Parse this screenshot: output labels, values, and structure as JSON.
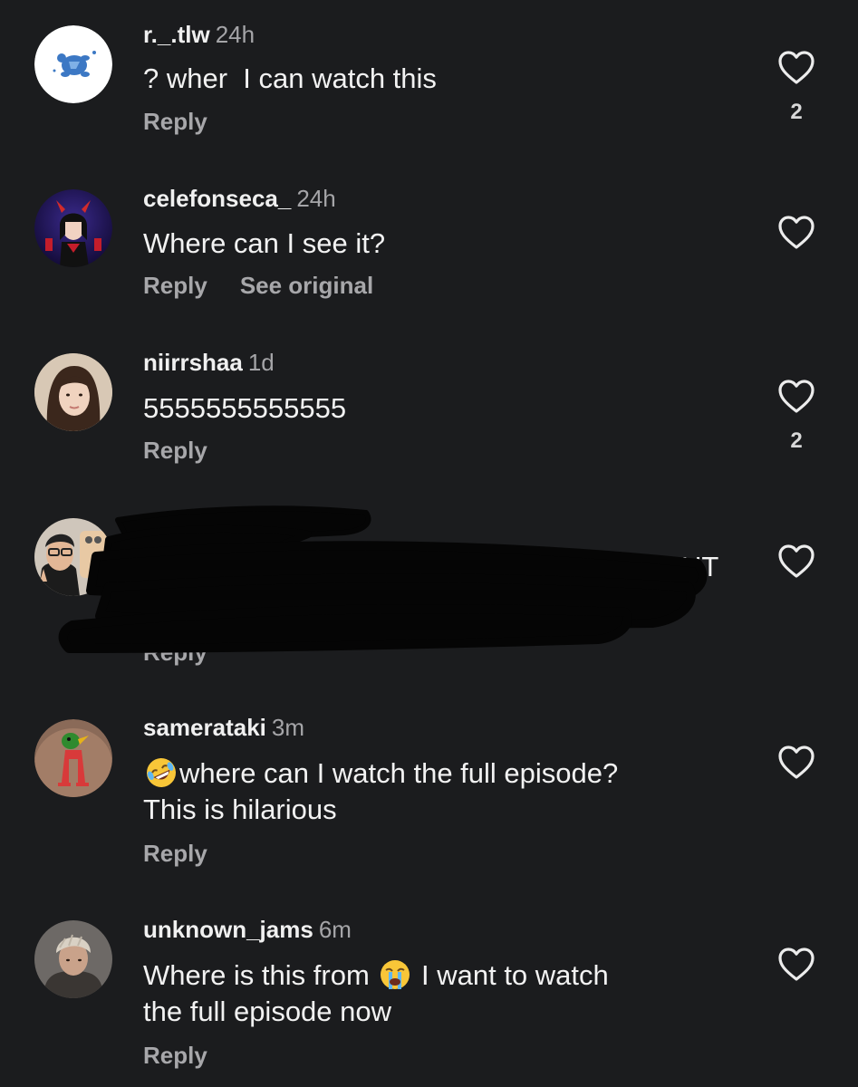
{
  "comments": [
    {
      "username": "r._.tlw",
      "time": "24h",
      "text": "? wher  I can watch this",
      "reply_label": "Reply",
      "like_count": "2"
    },
    {
      "username": "celefonseca_",
      "time": "24h",
      "text": "Where can I see it?",
      "reply_label": "Reply",
      "see_original_label": "See original"
    },
    {
      "username": "niirrshaa",
      "time": "1d",
      "text": "5555555555555",
      "reply_label": "Reply",
      "like_count": "2"
    },
    {
      "redacted": true,
      "reply_partial": "Reply",
      "text_partial": "UT"
    },
    {
      "username": "samerataki",
      "time": "3m",
      "emoji": "rolling-on-floor-laughing-emoji",
      "text_line1": "where can I watch the full episode?",
      "text_line2": "This is hilarious",
      "reply_label": "Reply"
    },
    {
      "username": "unknown_jams",
      "time": "6m",
      "text_before_emoji": "Where is this from ",
      "emoji": "loudly-crying-face-emoji",
      "text_after_emoji": " I want to watch",
      "text_line2": "the full episode now",
      "reply_label": "Reply"
    }
  ],
  "icons": {
    "like": "heart-outline-icon"
  },
  "colors": {
    "background": "#1b1c1e",
    "text_primary": "#f2f2f2",
    "text_secondary": "#a7a7aa"
  }
}
